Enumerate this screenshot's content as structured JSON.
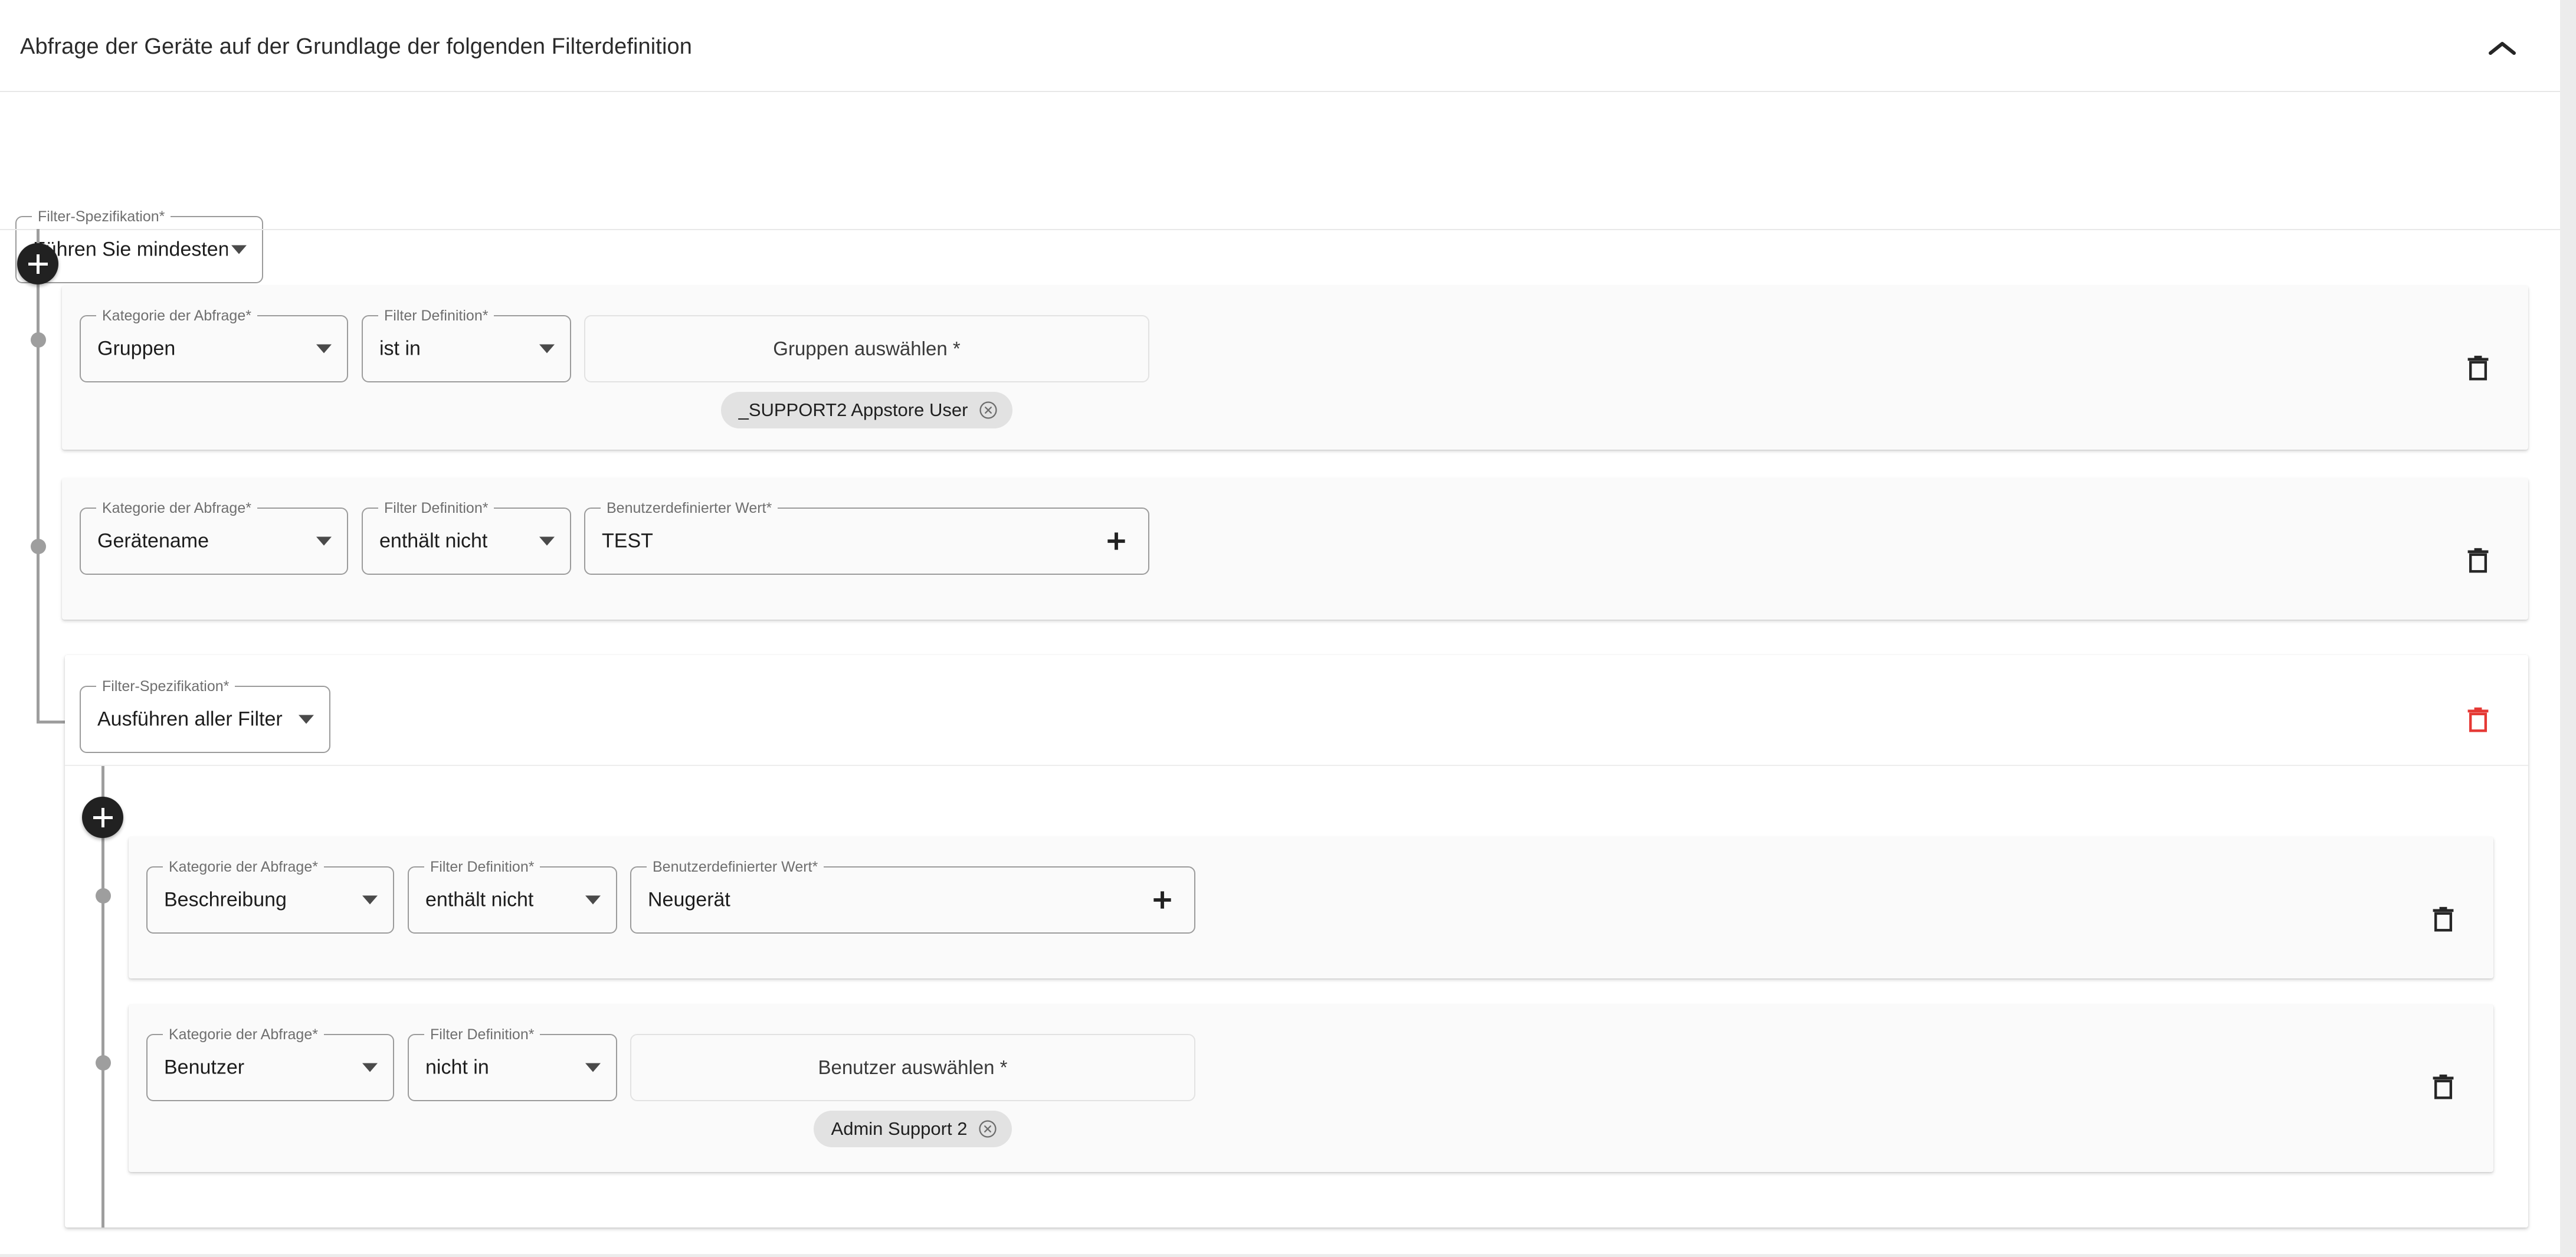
{
  "panel": {
    "title": "Abfrage der Geräte auf der Grundlage der folgenden Filterdefinition",
    "collapse_icon": "chevron-up-icon",
    "expanded": true
  },
  "labels": {
    "filter_spec": "Filter-Spezifikation*",
    "query_category": "Kategorie der Abfrage*",
    "filter_definition": "Filter Definition*",
    "custom_value": "Benutzerdefinierter Wert*"
  },
  "icons": {
    "delete_row": "trash-icon",
    "delete_group": "trash-icon",
    "add_filter": "plus-icon",
    "add_value": "plus-icon",
    "chip_remove": "close-circle-icon",
    "dropdown": "chevron-down-icon"
  },
  "colors": {
    "page_background": "#ececec",
    "card_background": "#ffffff",
    "row_background": "#fafafa",
    "accent_dark": "#212121",
    "rail": "#9e9e9e",
    "danger": "#e53935",
    "chip_background": "#e2e2e2",
    "text_primary": "#1d1d1d",
    "text_secondary": "#6f6f6f"
  },
  "root_group": {
    "spec_value": "Führen Sie mindestens ei...",
    "add_button_label": "+",
    "rows": [
      {
        "category": "Gruppen",
        "operator": "ist in",
        "value_kind": "picker",
        "value_placeholder": "Gruppen auswählen *",
        "chips": [
          "_SUPPORT2 Appstore User"
        ],
        "delete_label": "löschen"
      },
      {
        "category": "Gerätename",
        "operator": "enthält nicht",
        "value_kind": "text",
        "value_label": "Benutzerdefinierter Wert*",
        "value": "TEST",
        "chips": [],
        "delete_label": "löschen"
      }
    ]
  },
  "nested_group": {
    "spec_value": "Ausführen aller Filter",
    "delete_group_label": "Gruppe löschen",
    "add_button_label": "+",
    "rows": [
      {
        "category": "Beschreibung",
        "operator": "enthält nicht",
        "value_kind": "text",
        "value_label": "Benutzerdefinierter Wert*",
        "value": "Neugerät",
        "chips": [],
        "delete_label": "löschen"
      },
      {
        "category": "Benutzer",
        "operator": "nicht in",
        "value_kind": "picker",
        "value_placeholder": "Benutzer auswählen *",
        "chips": [
          "Admin Support 2"
        ],
        "delete_label": "löschen"
      }
    ]
  }
}
